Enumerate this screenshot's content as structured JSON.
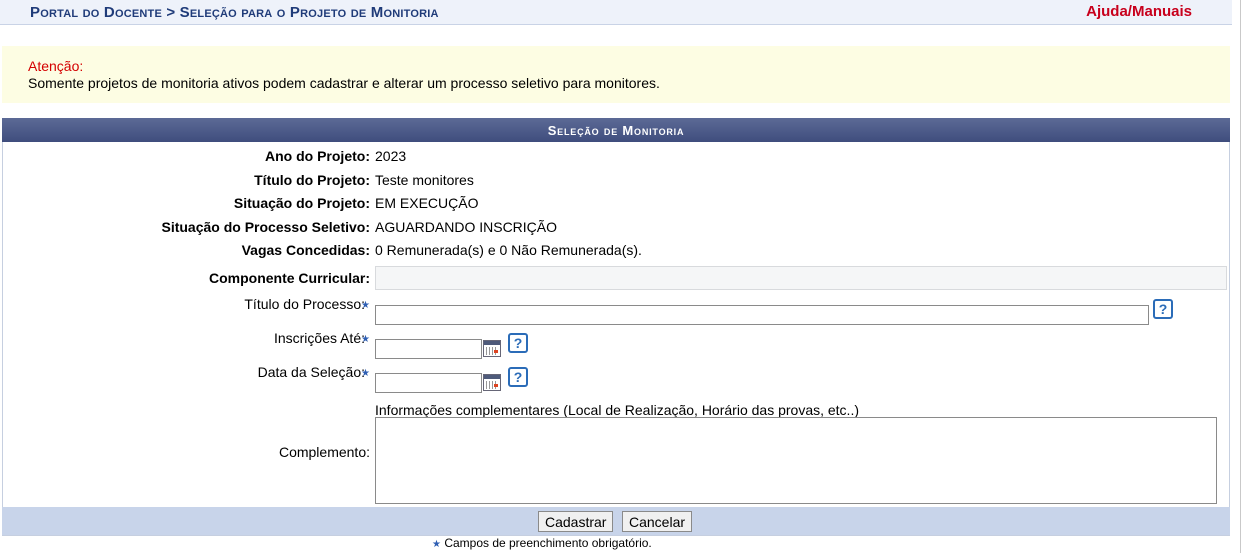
{
  "header": {
    "breadcrumb": "Portal do Docente > Seleção para o Projeto de Monitoria",
    "help_link": "Ajuda/Manuais"
  },
  "warning": {
    "title": "Atenção:",
    "message": "Somente projetos de monitoria ativos podem cadastrar e alterar um processo seletivo para monitores."
  },
  "form": {
    "caption": "Seleção de Monitoria",
    "ano_label": "Ano do Projeto:",
    "ano_value": "2023",
    "titulo_projeto_label": "Título do Projeto:",
    "titulo_projeto_value": "Teste monitores",
    "situacao_label": "Situação do Projeto:",
    "situacao_value": "EM EXECUÇÃO",
    "situacao_processo_label": "Situação do Processo Seletivo:",
    "situacao_processo_value": "AGUARDANDO INSCRIÇÃO",
    "vagas_label": "Vagas Concedidas:",
    "vagas_value": "0 Remunerada(s) e 0 Não Remunerada(s).",
    "componente_label": "Componente Curricular:",
    "componente_value": "",
    "titulo_processo_label": "Título do Processo:",
    "titulo_processo_value": "",
    "inscricoes_label": "Inscrições Até:",
    "inscricoes_value": "",
    "data_selecao_label": "Data da Seleção:",
    "data_selecao_value": "",
    "complemento_hint": "Informações complementares (Local de Realização, Horário das provas, etc..)",
    "complemento_label": "Complemento:",
    "complemento_value": "",
    "required_star": "★",
    "help_glyph": "?"
  },
  "buttons": {
    "submit": "Cadastrar",
    "cancel": "Cancelar"
  },
  "footnote": "Campos de preenchimento obrigatório.",
  "colors": {
    "breadcrumb": "#1f3b79",
    "help_link": "#c8001c",
    "caption_bg": "#4a5785",
    "warning_bg": "#fdfde3",
    "button_bar": "#c8d4ea"
  }
}
